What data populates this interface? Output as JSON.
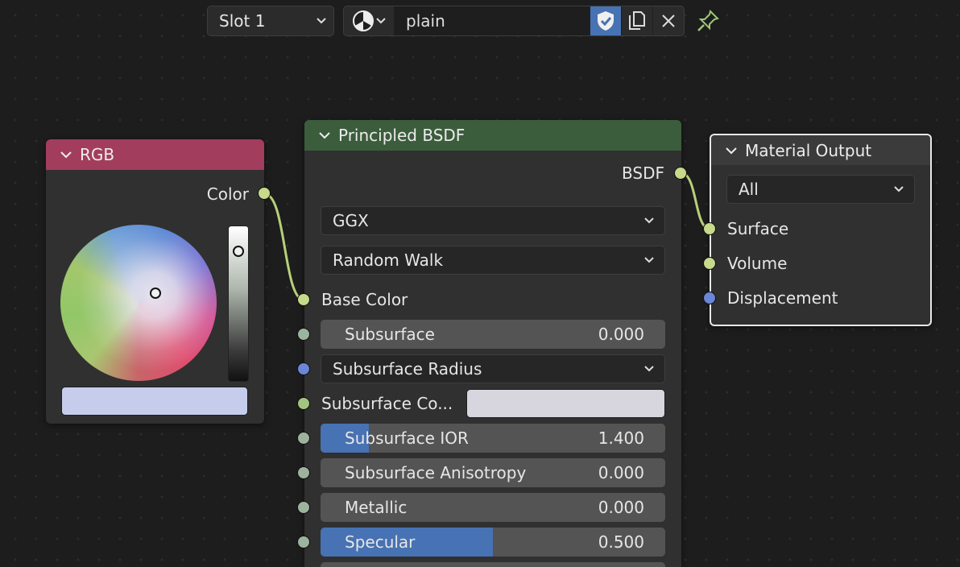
{
  "header": {
    "slot_label": "Slot 1",
    "material_name": "plain",
    "icons": [
      "chevron-down-icon",
      "material-sphere-icon",
      "fake-user-shield-icon",
      "duplicate-icon",
      "close-icon",
      "pin-icon"
    ]
  },
  "nodes": {
    "rgb": {
      "title": "RGB",
      "output_label": "Color",
      "color_hex": "#c6cdec",
      "header_color": "#a33d5d"
    },
    "bsdf": {
      "title": "Principled BSDF",
      "output_label": "BSDF",
      "header_color": "#3b5d3c",
      "distribution": "GGX",
      "subsurface_method": "Random Walk",
      "base_color_label": "Base Color",
      "subsurface": {
        "label": "Subsurface",
        "value": "0.000"
      },
      "subsurface_radius": "Subsurface Radius",
      "subsurface_color_label": "Subsurface Co...",
      "subsurface_color_hex": "#d7d5de",
      "subsurface_ior": {
        "label": "Subsurface IOR",
        "value": "1.400",
        "fill": 0.14
      },
      "subsurface_anisotropy": {
        "label": "Subsurface Anisotropy",
        "value": "0.000"
      },
      "metallic": {
        "label": "Metallic",
        "value": "0.000"
      },
      "specular": {
        "label": "Specular",
        "value": "0.500",
        "fill": 0.5
      }
    },
    "output": {
      "title": "Material Output",
      "target": "All",
      "inputs": [
        "Surface",
        "Volume",
        "Displacement"
      ]
    }
  },
  "colors": {
    "accent": "#4772b3",
    "link": "#b7d07a"
  }
}
